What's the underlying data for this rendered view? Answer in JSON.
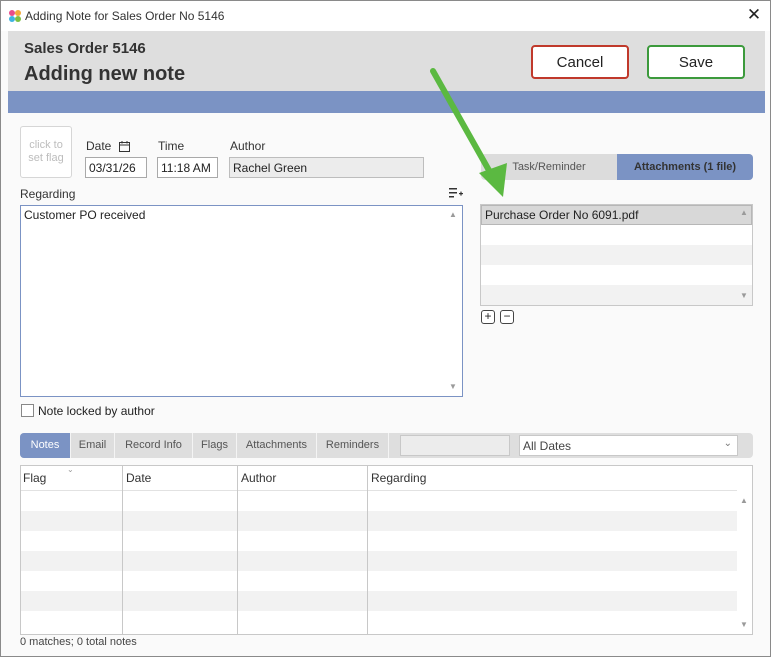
{
  "window": {
    "title": "Adding Note for Sales Order No 5146",
    "close_glyph": "✕"
  },
  "header": {
    "subtitle": "Sales Order 5146",
    "title": "Adding new note",
    "cancel_label": "Cancel",
    "save_label": "Save"
  },
  "form": {
    "flag_placeholder_line1": "click to",
    "flag_placeholder_line2": "set flag",
    "date_label": "Date",
    "date_value": "03/31/26",
    "time_label": "Time",
    "time_value": "11:18 AM",
    "author_label": "Author",
    "author_value": "Rachel Green",
    "regarding_label": "Regarding",
    "regarding_value": "Customer PO received",
    "locked_label": "Note locked by author"
  },
  "right_tabs": {
    "task": "Task/Reminder",
    "attachments": "Attachments (1 file)"
  },
  "attachments": {
    "files": [
      "Purchase Order No 6091.pdf"
    ]
  },
  "bottom_tabs": [
    "Notes",
    "Email",
    "Record Info",
    "Flags",
    "Attachments",
    "Reminders"
  ],
  "filter": {
    "search_value": "",
    "dates_value": "All Dates"
  },
  "grid": {
    "columns": [
      "Flag",
      "Date",
      "Author",
      "Regarding"
    ],
    "status": "0 matches; 0 total notes"
  },
  "annotation": {
    "arrow_color": "#5bb941"
  },
  "colors": {
    "accent": "#7b93c4",
    "cancel_border": "#c0392b",
    "save_border": "#3c9a3c"
  }
}
